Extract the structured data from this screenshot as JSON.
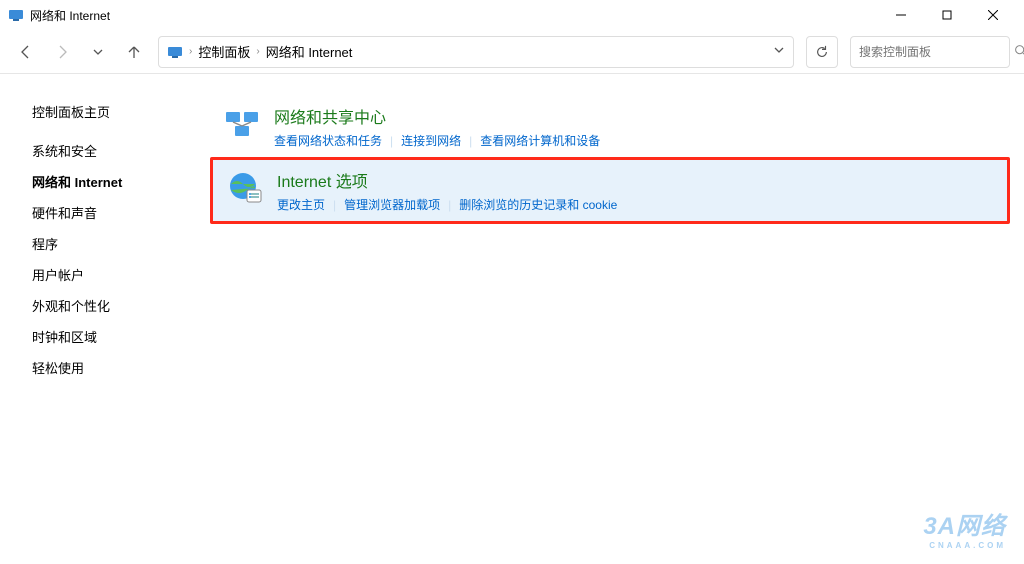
{
  "window": {
    "title": "网络和 Internet"
  },
  "breadcrumb": {
    "root": "控制面板",
    "current": "网络和 Internet"
  },
  "search": {
    "placeholder": "搜索控制面板"
  },
  "sidebar": {
    "items": [
      {
        "label": "控制面板主页",
        "active": false
      },
      {
        "label": "系统和安全",
        "active": false
      },
      {
        "label": "网络和 Internet",
        "active": true
      },
      {
        "label": "硬件和声音",
        "active": false
      },
      {
        "label": "程序",
        "active": false
      },
      {
        "label": "用户帐户",
        "active": false
      },
      {
        "label": "外观和个性化",
        "active": false
      },
      {
        "label": "时钟和区域",
        "active": false
      },
      {
        "label": "轻松使用",
        "active": false
      }
    ]
  },
  "categories": [
    {
      "id": "network-sharing",
      "title": "网络和共享中心",
      "icon": "network-center-icon",
      "highlighted": false,
      "links": [
        "查看网络状态和任务",
        "连接到网络",
        "查看网络计算机和设备"
      ]
    },
    {
      "id": "internet-options",
      "title": "Internet 选项",
      "icon": "internet-options-icon",
      "highlighted": true,
      "links": [
        "更改主页",
        "管理浏览器加载项",
        "删除浏览的历史记录和 cookie"
      ]
    }
  ],
  "watermark": {
    "main": "3A网络",
    "sub": "CNAAA.COM"
  }
}
